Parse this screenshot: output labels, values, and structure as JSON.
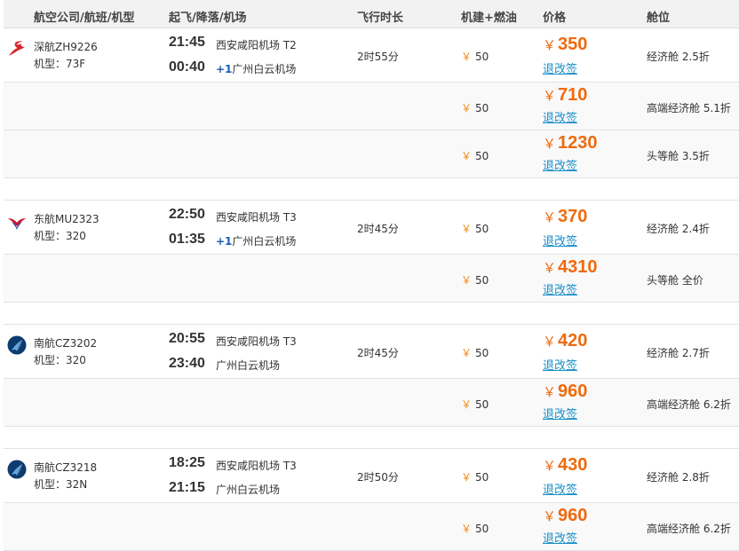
{
  "header": {
    "airline_col": "航空公司/航班/机型",
    "time_col": "起飞/降落/机场",
    "duration_col": "飞行时长",
    "tax_col": "机建+燃油",
    "price_col": "价格",
    "cabin_col": "舱位"
  },
  "labels": {
    "model_prefix": "机型：",
    "refund": "退改签",
    "yen": "￥",
    "next_day": "+1"
  },
  "airline_logos": {
    "shenzhen": {
      "icon": "shenzhen-airlines-logo-icon",
      "color": "#d7262e"
    },
    "eastern": {
      "icon": "china-eastern-logo-icon",
      "color": "#c8102e",
      "color2": "#1f3a93"
    },
    "southern": {
      "icon": "china-southern-logo-icon",
      "color": "#0d3b6e",
      "color2": "#5fa8e0"
    }
  },
  "flights": [
    {
      "logo": "shenzhen",
      "airline": "深航ZH9226",
      "model": "73F",
      "dep_time": "21:45",
      "dep_airport": "西安咸阳机场 T2",
      "arr_time": "00:40",
      "next_day": true,
      "arr_airport": "广州白云机场",
      "duration": "2时55分",
      "fares": [
        {
          "tax": "50",
          "price": "350",
          "cabin": "经济舱 2.5折"
        },
        {
          "tax": "50",
          "price": "710",
          "cabin": "高端经济舱 5.1折"
        },
        {
          "tax": "50",
          "price": "1230",
          "cabin": "头等舱 3.5折"
        }
      ]
    },
    {
      "logo": "eastern",
      "airline": "东航MU2323",
      "model": "320",
      "dep_time": "22:50",
      "dep_airport": "西安咸阳机场 T3",
      "arr_time": "01:35",
      "next_day": true,
      "arr_airport": "广州白云机场",
      "duration": "2时45分",
      "fares": [
        {
          "tax": "50",
          "price": "370",
          "cabin": "经济舱 2.4折"
        },
        {
          "tax": "50",
          "price": "4310",
          "cabin": "头等舱 全价"
        }
      ]
    },
    {
      "logo": "southern",
      "airline": "南航CZ3202",
      "model": "320",
      "dep_time": "20:55",
      "dep_airport": "西安咸阳机场 T3",
      "arr_time": "23:40",
      "next_day": false,
      "arr_airport": "广州白云机场",
      "duration": "2时45分",
      "fares": [
        {
          "tax": "50",
          "price": "420",
          "cabin": "经济舱 2.7折"
        },
        {
          "tax": "50",
          "price": "960",
          "cabin": "高端经济舱 6.2折"
        }
      ]
    },
    {
      "logo": "southern",
      "airline": "南航CZ3218",
      "model": "32N",
      "dep_time": "18:25",
      "dep_airport": "西安咸阳机场 T3",
      "arr_time": "21:15",
      "next_day": false,
      "arr_airport": "广州白云机场",
      "duration": "2时50分",
      "fares": [
        {
          "tax": "50",
          "price": "430",
          "cabin": "经济舱 2.8折"
        },
        {
          "tax": "50",
          "price": "960",
          "cabin": "高端经济舱 6.2折"
        }
      ]
    }
  ]
}
